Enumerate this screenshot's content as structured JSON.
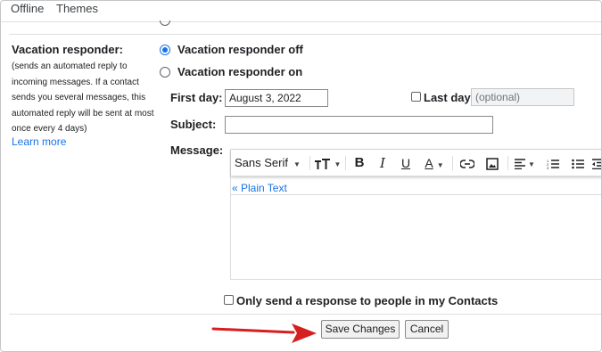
{
  "tabs": [
    "Offline",
    "Themes"
  ],
  "vacation": {
    "title": "Vacation responder:",
    "description": "(sends an automated reply to incoming messages. If a contact sends you several messages, this automated reply will be sent at most once every 4 days)",
    "learn_more": "Learn more",
    "off_label": "Vacation responder off",
    "on_label": "Vacation responder on",
    "selected": "off"
  },
  "form": {
    "first_day_label": "First day:",
    "first_day_value": "August 3, 2022",
    "last_day_label": "Last day:",
    "last_day_placeholder": "(optional)",
    "subject_label": "Subject:",
    "subject_value": "",
    "message_label": "Message:"
  },
  "toolbar": {
    "font": "Sans Serif",
    "size_icon": "text-size-icon",
    "bold": "B",
    "italic": "I",
    "underline": "U",
    "text_color": "A",
    "link_icon": "link-icon",
    "image_icon": "image-icon",
    "align_icon": "align-left-icon",
    "numbered_list_icon": "numbered-list-icon",
    "bulleted_list_icon": "bulleted-list-icon",
    "indent_icon": "indent-less-icon"
  },
  "editor": {
    "plain_text_link": "« Plain Text",
    "body": ""
  },
  "contacts_only_label": "Only send a response to people in my Contacts",
  "buttons": {
    "save": "Save Changes",
    "cancel": "Cancel"
  },
  "colors": {
    "accent": "#1a73e8",
    "arrow": "#d61f1f"
  }
}
